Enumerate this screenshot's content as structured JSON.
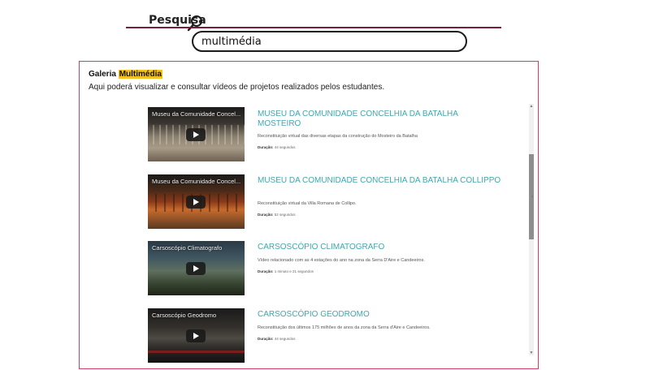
{
  "search": {
    "label": "Pesquisa",
    "query": "multimédia"
  },
  "gallery": {
    "title_prefix": "Galeria",
    "title_highlight": "Multimédia",
    "subtitle": "Aqui poderá visualizar e consultar vídeos de projetos realizados pelos estudantes.",
    "duration_label": "Duração:",
    "items": [
      {
        "title": "MUSEU DA COMUNIDADE CONCELHIA DA BATALHA MOSTEIRO",
        "thumb_caption": "Museu da Comunidade Concel...",
        "description": "Reconstituição virtual das diversas etapas da construção do Mosteiro da Batalha",
        "duration": "44 segundos"
      },
      {
        "title": "MUSEU DA COMUNIDADE CONCELHIA DA BATALHA COLLIPPO",
        "thumb_caption": "Museu da Comunidade Concel...",
        "description": "Reconstituição virtual da Villa Romana de Collipo.",
        "duration": "52 segundos"
      },
      {
        "title": "CARSOSCÓPIO CLIMATOGRAFO",
        "thumb_caption": "Carsoscópio Climatografo",
        "description": "Vídeo relacionado com as 4 estações do ano na zona da Serra D'Aire e Candeeiros.",
        "duration": "1 minuto e 21 segundos"
      },
      {
        "title": "CARSOSCÓPIO GEODROMO",
        "thumb_caption": "Carsoscópio Geodromo",
        "description": "Reconstituição dos últimos 175 milhões de anos da zona da Serra d'Aire e Candeeiros.",
        "duration": "44 segundos"
      }
    ]
  },
  "colors": {
    "accent_rule": "#7a1d3a",
    "panel_border": "#cf3f63",
    "highlight": "#f4c21e",
    "title_link": "#3fa7ad"
  },
  "icons": {
    "search": "magnifier-icon",
    "play": "play-icon"
  }
}
